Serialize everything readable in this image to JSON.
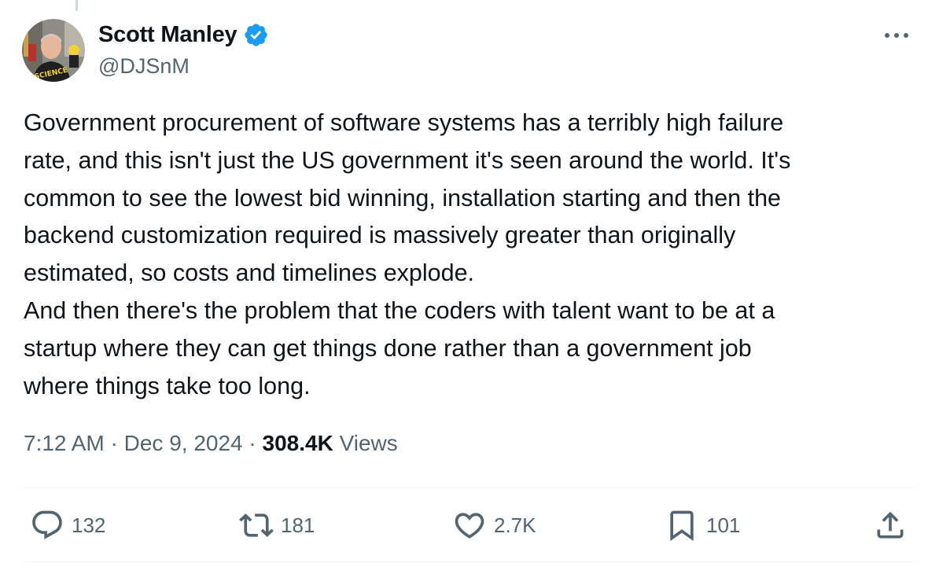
{
  "author": {
    "name": "Scott Manley",
    "handle": "@DJSnM",
    "verified": true,
    "avatar_shirt_text": "SCIENCE"
  },
  "tweet": {
    "paragraphs": [
      "Government procurement of software systems has a terribly high failure\nrate, and this isn't just the US government it's seen around the world. It's\ncommon to see the lowest bid winning, installation starting and then the\nbackend customization required is massively greater than originally\nestimated, so costs and timelines explode.",
      "And then there's the problem that the coders with talent want to be at a\nstartup where they can get things done rather than a government job\nwhere things take too long."
    ]
  },
  "meta": {
    "time": "7:12 AM",
    "separator": "·",
    "date": "Dec 9, 2024",
    "views_count": "308.4K",
    "views_label": "Views"
  },
  "actions": {
    "replies": "132",
    "reposts": "181",
    "likes": "2.7K",
    "bookmarks": "101"
  },
  "icons": {
    "verified": "verified-badge-icon",
    "more": "more-horizontal-icon",
    "reply": "reply-bubble-icon",
    "repost": "repost-icon",
    "like": "heart-icon",
    "bookmark": "bookmark-icon",
    "share": "share-icon"
  },
  "colors": {
    "text_primary": "#0f1419",
    "text_secondary": "#536471",
    "verified_blue": "#1d9bf0",
    "divider": "#eff3f4"
  }
}
